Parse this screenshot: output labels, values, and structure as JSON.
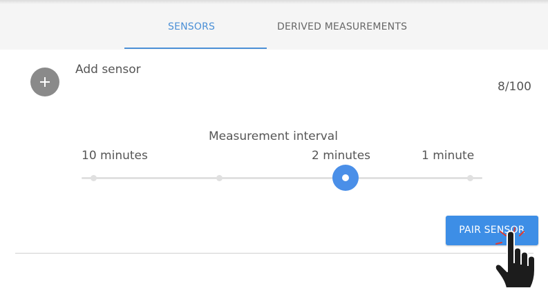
{
  "tabs": [
    {
      "label": "SENSORS",
      "active": true
    },
    {
      "label": "DERIVED MEASUREMENTS",
      "active": false
    }
  ],
  "add_sensor": {
    "icon": "plus-icon",
    "label": "Add sensor"
  },
  "sensor_count": "8/100",
  "interval": {
    "title": "Measurement interval",
    "labels": [
      "10 minutes",
      "2 minutes",
      "1 minute"
    ],
    "selected": "2 minutes"
  },
  "pair_button": {
    "label": "PAIR SENSOR"
  },
  "cursor_icon": "pointing-hand-icon",
  "colors": {
    "accent": "#4a8fd6",
    "button": "#3d8ee6",
    "add_button": "#8a8a8a"
  }
}
